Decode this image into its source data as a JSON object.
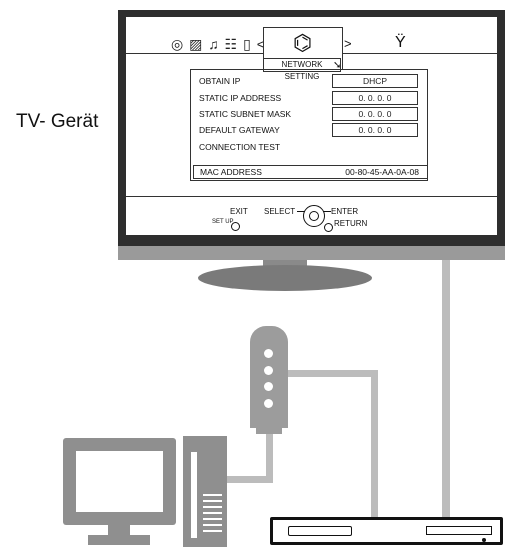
{
  "tv_label": "TV- Gerät",
  "menu": {
    "icons": [
      "disc-icon",
      "picture-icon",
      "music-icon",
      "settings-list-icon",
      "memory-card-icon",
      "network-icon",
      "wrench-icon"
    ],
    "icon_glyphs": {
      "disc": "◎",
      "picture": "▨",
      "music": "♫",
      "settings": "☷",
      "card": "▯",
      "network": "⌬",
      "wrench": "Ÿ"
    },
    "active_tab_label": "NETWORK SETTING"
  },
  "settings": {
    "rows": [
      {
        "label": "OBTAIN IP",
        "value": "DHCP"
      },
      {
        "label": "STATIC IP ADDRESS",
        "value": "0. 0. 0. 0"
      },
      {
        "label": "STATIC SUBNET MASK",
        "value": "0. 0. 0. 0"
      },
      {
        "label": "DEFAULT GATEWAY",
        "value": "0. 0. 0. 0"
      },
      {
        "label": "CONNECTION TEST",
        "value": ""
      }
    ],
    "mac_label": "MAC ADDRESS",
    "mac_value": "00-80-45-AA-0A-08"
  },
  "controls": {
    "exit": "EXIT",
    "setup": "SET UP",
    "select": "SELECT",
    "enter": "ENTER",
    "return": "RETURN"
  },
  "colors": {
    "tv_bezel": "#2e2e2e",
    "device_gray": "#9c9c9c",
    "cable_gray": "#bcbcbc"
  }
}
